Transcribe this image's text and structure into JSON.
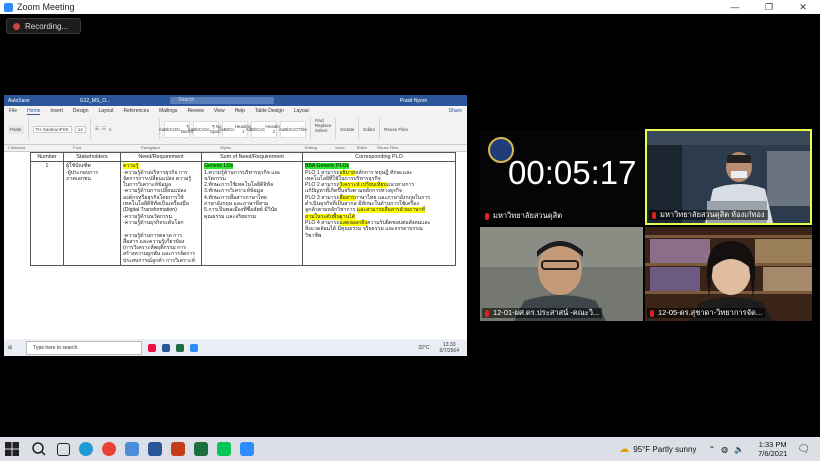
{
  "zoom": {
    "title": "Zoom Meeting",
    "recording_label": "Recording...",
    "controls": [
      "—",
      "❐",
      "✕"
    ]
  },
  "word": {
    "autosave": "AutoSave",
    "doc_name": "G12_MS_O...",
    "search_placeholder": "Search",
    "user": "Prasit Nyom",
    "user_initials": "PN",
    "tabs": [
      "File",
      "Home",
      "Insert",
      "Design",
      "Layout",
      "References",
      "Mailings",
      "Review",
      "View",
      "Help",
      "Table Design",
      "Layout"
    ],
    "active_tab": "Home",
    "share_label": "Share",
    "font_name": "TH SarabunPSK",
    "font_size": "14",
    "styles": [
      "AaBbCcDc",
      "AaBbCcDc",
      "AaBbCc",
      "AaBbCcC",
      "AaBbCcC"
    ],
    "style_names": [
      "¶ Normal",
      "¶ No Spac...",
      "Heading 1",
      "Heading 2",
      "Title"
    ],
    "ribbon_groups": [
      "Clipboard",
      "Font",
      "Paragraph",
      "Styles",
      "Editing",
      "Voice",
      "Editor",
      "Reuse Files"
    ],
    "editing_items": [
      "Find",
      "Replace",
      "Select"
    ],
    "voice_label": "Dictate",
    "editor_label": "Editor",
    "reuse_label": "Reuse Files",
    "paste_label": "Paste",
    "table": {
      "headers": [
        "Number",
        "Stakeholders",
        "Need/Requirement",
        "Sum of Need/Requirement",
        "Corresponding PLO"
      ],
      "row_number": "1",
      "stakeholders": "ผู้ใช้บัณฑิต\n-ผู้ประกอบการ\nภาคเอกชน",
      "need_title": "ความรู้",
      "need_lines": [
        "-ความรู้ด้านบริหารธุรกิจ การ",
        "จัดการการเปลี่ยนแปลง ความรู้",
        "ในการวิเคราะห์ข้อมูล",
        "-ความรู้ด้านการเปลี่ยนแปลง",
        "องค์กรหรือธุรกิจโดยการใช้",
        "เทคโนโลยีดิจิทัลเป็นเครื่องมือ",
        "(Digital Transformation)",
        "-ความรู้ด้านนวัตกรรม",
        "-ความรู้ด้านธุรกิจระดับโลก",
        "",
        "-ความรู้ด้านการตลาด การ",
        "สื่อสาร และความรู้เกี่ยวข้อง",
        "(การวิเคราะห์พฤติกรรม การ",
        "สร้างความผูกพัน และการจัดการ",
        "ประสบการณ์ลูกค้า การวิเคราะห์"
      ],
      "sum_title": "Generic LOs",
      "sum_lines": [
        "1.ความรู้ด้านการบริหารธุรกิจ และ",
        "นวัตกรรม",
        "2.ทักษะการใช้เทคโนโลยีดิจิทัล",
        "3.ทักษะการวิเคราะห์ข้อมูล",
        "4.ทักษะการสื่อสารภาษาไทย",
        "ภาษาอังกฤษ และภาษาที่สาม",
        "5.การเป็นพลเมืองที่ซื่อสัตย์ มีวินัย",
        "คุณธรรม และจริยธรรม"
      ],
      "plo_title": "BBA Generic PLOs",
      "plo_lines": [
        {
          "pre": "PLO 1 สามารถ",
          "hl": "อธิบาย",
          "post": "หลักการ ทฤษฎี ทักษะและ"
        },
        {
          "pre": "เทคโนโลยีที่ใช้ในการบริหารธุรกิจ",
          "hl": "",
          "post": ""
        },
        {
          "pre": "PLO 2 สามารถ",
          "hl": "วิเคราะห์ เปรียบเทียบ",
          "post": "แนวทางการ"
        },
        {
          "pre": "แก้ปัญหาที่เกิดขึ้นจริงตามหลักการทางธุรกิจ",
          "hl": "",
          "post": ""
        },
        {
          "pre": "PLO 3 สามารถ",
          "hl": "สื่อสาร",
          "post": "ภาษาไทย และภาษาอังกฤษในการ"
        },
        {
          "pre": "ดำเนินธุรกิจที่เป็นสากล มีทักษะในด้านการใช้เครื่อง",
          "hl": "",
          "post": ""
        },
        {
          "pre": "ลูกค้าตามหลักวิชาการ ",
          "hl": "และสามารถสื่อสารด้วยภาษาที่",
          "post": ""
        },
        {
          "pre": "",
          "hl": "สามในระดับพื้นฐานได้",
          "post": ""
        },
        {
          "pre": "PLO 4 สามารถ",
          "hl": "แสดงออกถึง",
          "post": "ความรับผิดชอบต่อสังคมและ"
        },
        {
          "pre": "สิ่งแวดล้อมได้ มีคุณธรรม จริยธรรม และจรรยาบรรณ",
          "hl": "",
          "post": ""
        },
        {
          "pre": "วิชาชีพ",
          "hl": "",
          "post": ""
        }
      ]
    },
    "status_left": "Page 6 of 15    19 of 1668 words",
    "status_zoom": "110%"
  },
  "inner_taskbar": {
    "search_placeholder": "Type here to search",
    "weather": "32°C",
    "time": "13:33",
    "date": "6/7/2564"
  },
  "video": {
    "timer": "00:05:17",
    "tiles": [
      {
        "name": "มหาวิทยาลัยสวนดุสิต"
      },
      {
        "name": "มหาวิทยาลัยสวนดุสิต ห้องเก๋ทอง"
      },
      {
        "name": "12-01-ผศ.ดร.ประสาสน์ -คณะวิ..."
      },
      {
        "name": "12-05-ดร.สุชาดา-วิทยาการจัด..."
      }
    ]
  },
  "taskbar": {
    "search_placeholder": "Type here to search",
    "weather": "95°F  Partly sunny",
    "time": "1:33 PM",
    "date": "7/6/2021"
  }
}
